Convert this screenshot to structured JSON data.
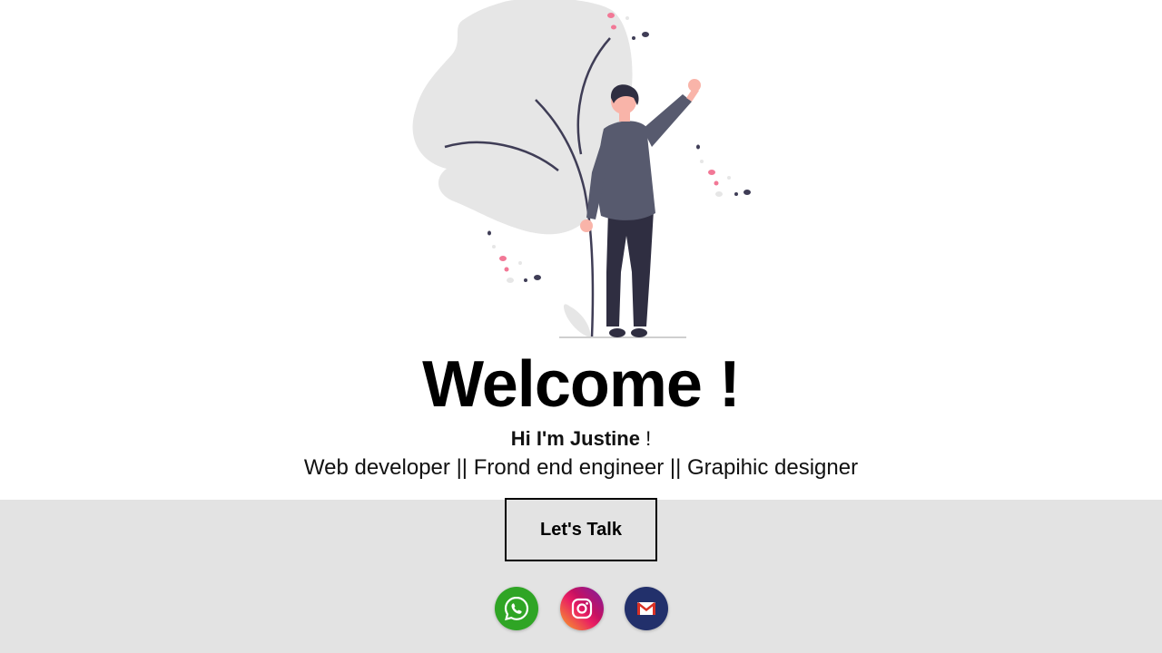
{
  "hero": {
    "title": "Welcome !",
    "greeting_name": "Hi I'm Justine",
    "greeting_suffix": " !",
    "roles": "Web developer || Frond end engineer || Grapihic designer"
  },
  "cta": {
    "label": "Let's Talk"
  },
  "social": [
    {
      "icon": "whatsapp-icon",
      "color": "#2fa525"
    },
    {
      "icon": "instagram-icon",
      "color": "#e91e63"
    },
    {
      "icon": "gmail-icon",
      "color": "#22306b"
    }
  ],
  "colors": {
    "footer_background": "#e3e3e3",
    "illustration_shape": "#e6e6e6",
    "illustration_person": "#575a6e",
    "illustration_accent": "#f27896"
  }
}
